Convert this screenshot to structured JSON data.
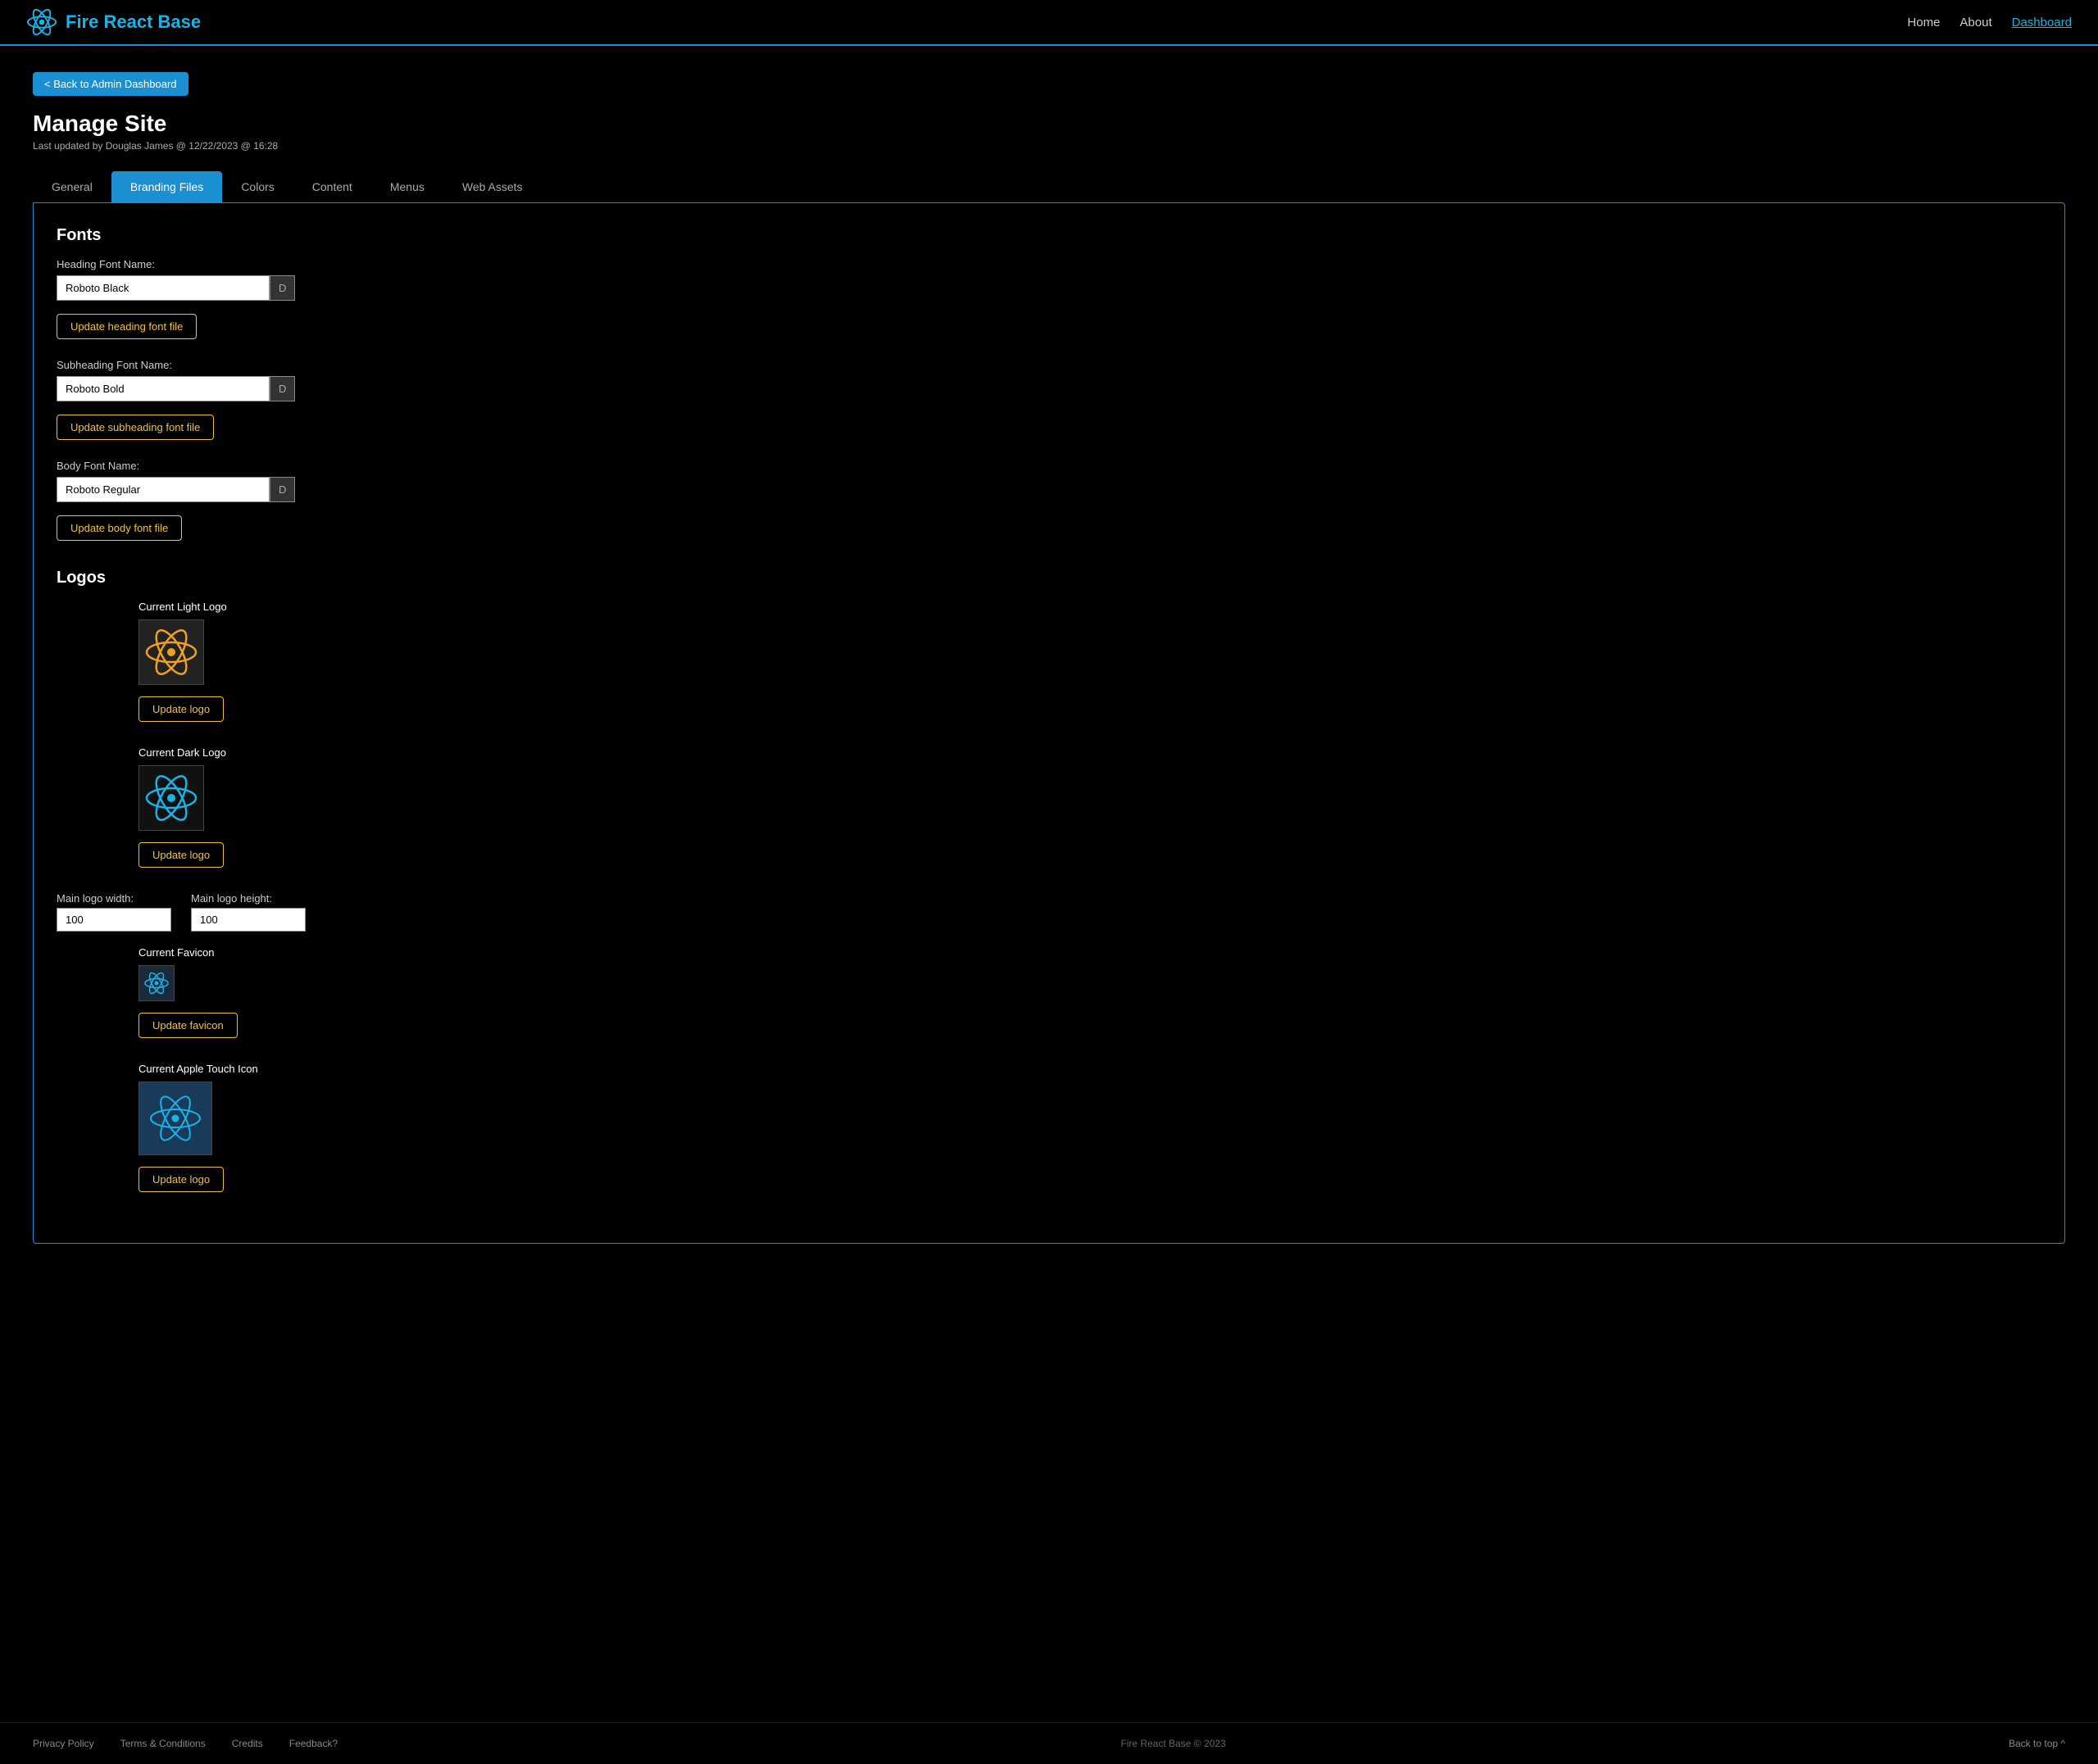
{
  "navbar": {
    "brand": "Fire React Base",
    "links": [
      {
        "label": "Home",
        "active": false
      },
      {
        "label": "About",
        "active": false
      },
      {
        "label": "Dashboard",
        "active": true
      }
    ]
  },
  "back_button": "< Back to Admin Dashboard",
  "page": {
    "title": "Manage Site",
    "subtitle": "Last updated by Douglas James @ 12/22/2023 @ 16:28"
  },
  "tabs": [
    {
      "label": "General",
      "active": false
    },
    {
      "label": "Branding Files",
      "active": true
    },
    {
      "label": "Colors",
      "active": false
    },
    {
      "label": "Content",
      "active": false
    },
    {
      "label": "Menus",
      "active": false
    },
    {
      "label": "Web Assets",
      "active": false
    }
  ],
  "fonts": {
    "section_title": "Fonts",
    "heading": {
      "label": "Heading Font Name:",
      "value": "Roboto Black",
      "btn": "Update heading font file"
    },
    "subheading": {
      "label": "Subheading Font Name:",
      "value": "Roboto Bold",
      "btn": "Update subheading font file"
    },
    "body": {
      "label": "Body Font Name:",
      "value": "Roboto Regular",
      "btn": "Update body font file"
    }
  },
  "logos": {
    "section_title": "Logos",
    "light_logo": {
      "title": "Current Light Logo",
      "btn": "Update logo"
    },
    "dark_logo": {
      "title": "Current Dark Logo",
      "btn": "Update logo"
    },
    "width_label": "Main logo width:",
    "height_label": "Main logo height:",
    "width_value": "100",
    "height_value": "100",
    "favicon": {
      "title": "Current Favicon",
      "btn": "Update favicon"
    },
    "touch_icon": {
      "title": "Current Apple Touch Icon",
      "btn": "Update logo"
    }
  },
  "footer": {
    "links": [
      {
        "label": "Privacy Policy"
      },
      {
        "label": "Terms & Conditions"
      },
      {
        "label": "Credits"
      },
      {
        "label": "Feedback?"
      }
    ],
    "copyright": "Fire React Base © 2023",
    "back_top": "Back to top ^"
  }
}
